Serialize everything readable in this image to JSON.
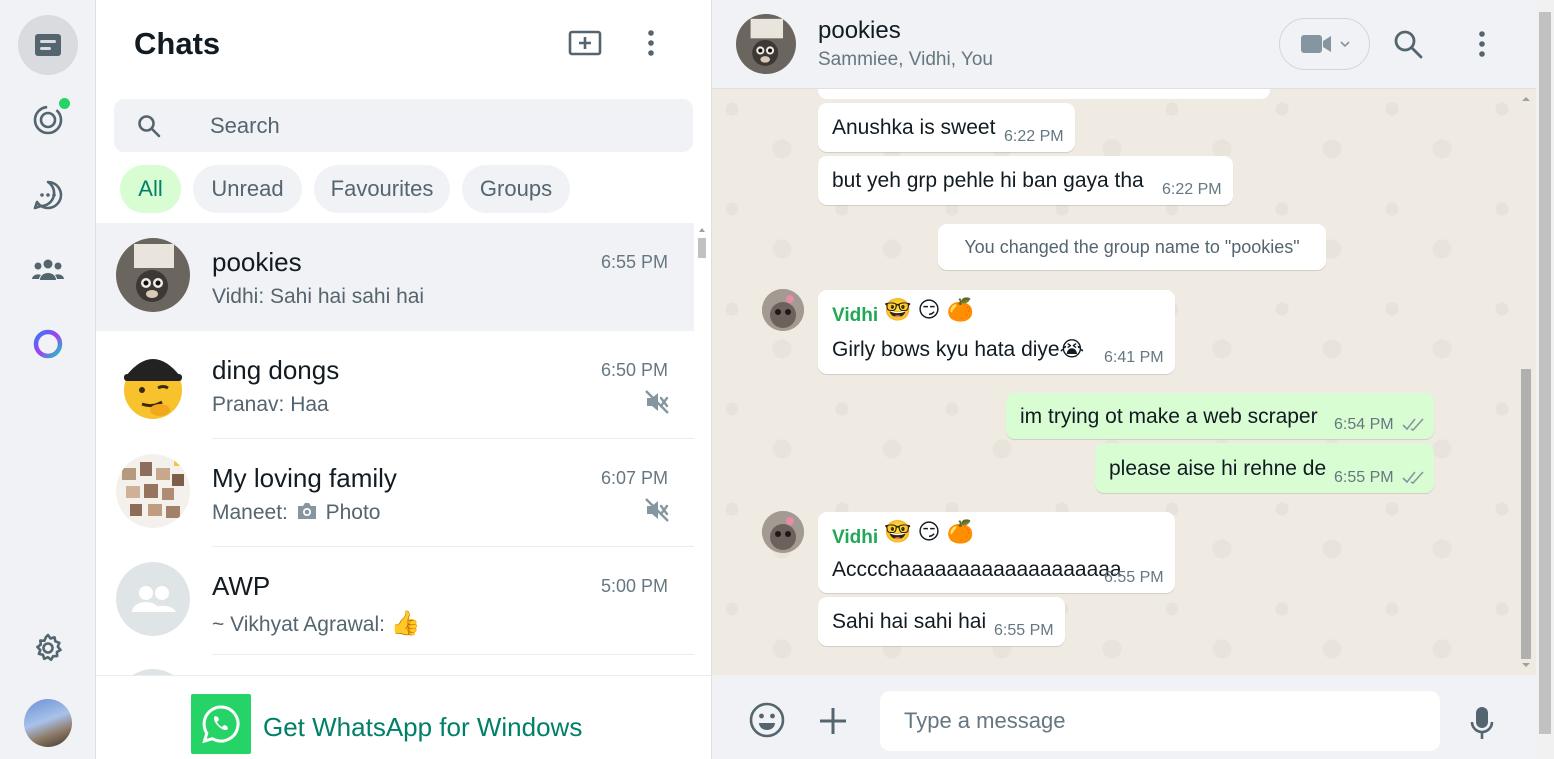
{
  "rail": {
    "items": [
      {
        "name": "chats-icon"
      },
      {
        "name": "status-icon"
      },
      {
        "name": "channels-icon"
      },
      {
        "name": "communities-icon"
      },
      {
        "name": "meta-ai-icon"
      }
    ],
    "settings": "gear-icon",
    "profile": "avatar"
  },
  "list": {
    "title": "Chats",
    "search_placeholder": "Search",
    "filters": [
      "All",
      "Unread",
      "Favourites",
      "Groups"
    ],
    "active_filter": "All",
    "chats": [
      {
        "name": "pookies",
        "time": "6:55 PM",
        "preview": "Vidhi: Sahi hai sahi hai",
        "muted": false,
        "selected": true
      },
      {
        "name": "ding dongs",
        "time": "6:50 PM",
        "preview": "Pranav: Haa",
        "muted": true,
        "selected": false
      },
      {
        "name": "My loving family",
        "time": "6:07 PM",
        "preview_sender": "Maneet:",
        "preview": "Photo",
        "muted": true,
        "selected": false
      },
      {
        "name": "AWP",
        "time": "5:00 PM",
        "preview": "~ Vikhyat Agrawal:",
        "preview_emoji": "👍",
        "muted": false,
        "selected": false
      }
    ],
    "get_app": "Get WhatsApp for Windows"
  },
  "conversation": {
    "name": "pookies",
    "members": "Sammiee, Vidhi, You",
    "messages": [
      {
        "type": "in",
        "text": "Anushka is sweet",
        "time": "6:22 PM"
      },
      {
        "type": "in",
        "text": "but yeh grp pehle hi ban gaya tha",
        "time": "6:22 PM"
      },
      {
        "type": "system",
        "text": "You changed the group name to \"pookies\""
      },
      {
        "type": "in",
        "sender": "Vidhi",
        "sender_emoji": "🤓 😏 🍊",
        "text": "Girly bows kyu hata diye😭",
        "time": "6:41 PM"
      },
      {
        "type": "out",
        "text": "im trying ot make a web scraper",
        "time": "6:54 PM"
      },
      {
        "type": "out",
        "text": "please aise hi rehne de",
        "time": "6:55 PM"
      },
      {
        "type": "in",
        "sender": "Vidhi",
        "sender_emoji": "🤓 😏 🍊",
        "text": "Accccha",
        "text2": "aaaaaaaaaaaaaaaaaa",
        "time": "6:55 PM"
      },
      {
        "type": "in",
        "text": "Sahi hai sahi hai",
        "time": "6:55 PM"
      }
    ],
    "composer_placeholder": "Type a message"
  },
  "colors": {
    "accent": "#008069",
    "outgoing_bubble": "#d9fdd3",
    "chat_bg": "#efeae2",
    "sender_name": "#1fa855",
    "online_dot": "#25d366"
  }
}
